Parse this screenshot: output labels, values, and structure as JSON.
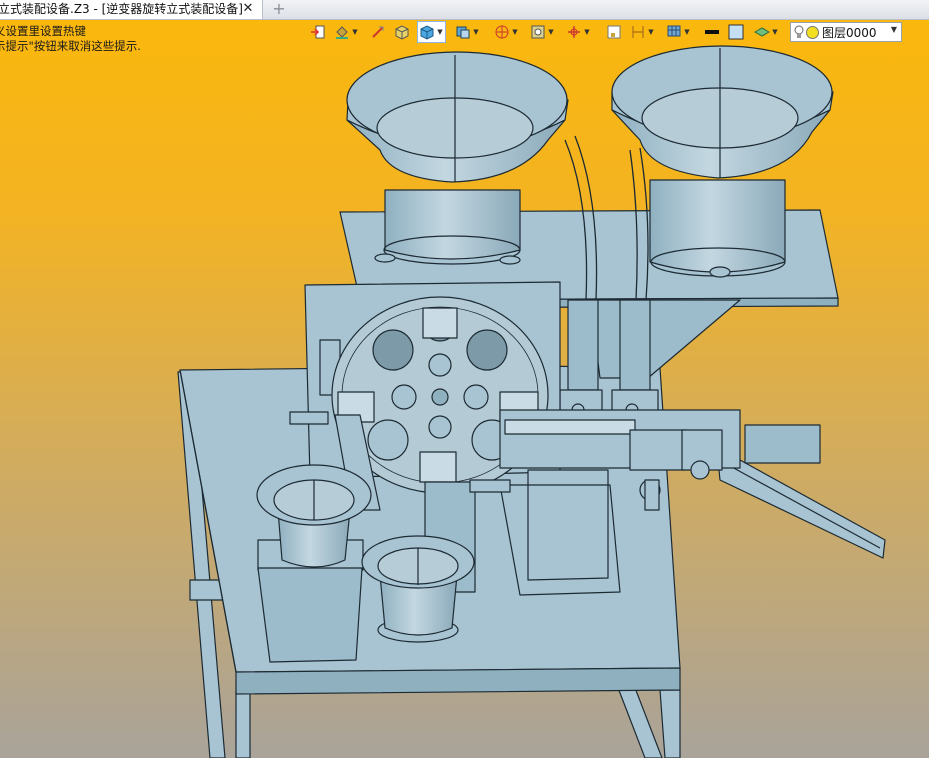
{
  "tab": {
    "title": "立式装配设备.Z3 - [逆变器旋转立式装配设备]",
    "close": "✕",
    "add": "+"
  },
  "hints": {
    "line1": "义设置里设置热键",
    "line2": "示提示\"按钮来取消这些提示."
  },
  "toolbar": {
    "icons": [
      "import-icon",
      "paint-bucket-icon",
      "line-style-icon",
      "box-shaded-icon",
      "cube-view-icon",
      "view-orient-icon",
      "render-mode-icon",
      "clip-plane-icon",
      "axis-icon",
      "frame-icon",
      "dimension-icon",
      "grid-icon",
      "color-black-icon",
      "color-box-icon",
      "layer-manager-icon"
    ],
    "layer_name": "图层0000"
  },
  "colors": {
    "accent": "#fbb80a",
    "model_fill": "#a8c4d2",
    "model_line": "#1c2a33"
  }
}
